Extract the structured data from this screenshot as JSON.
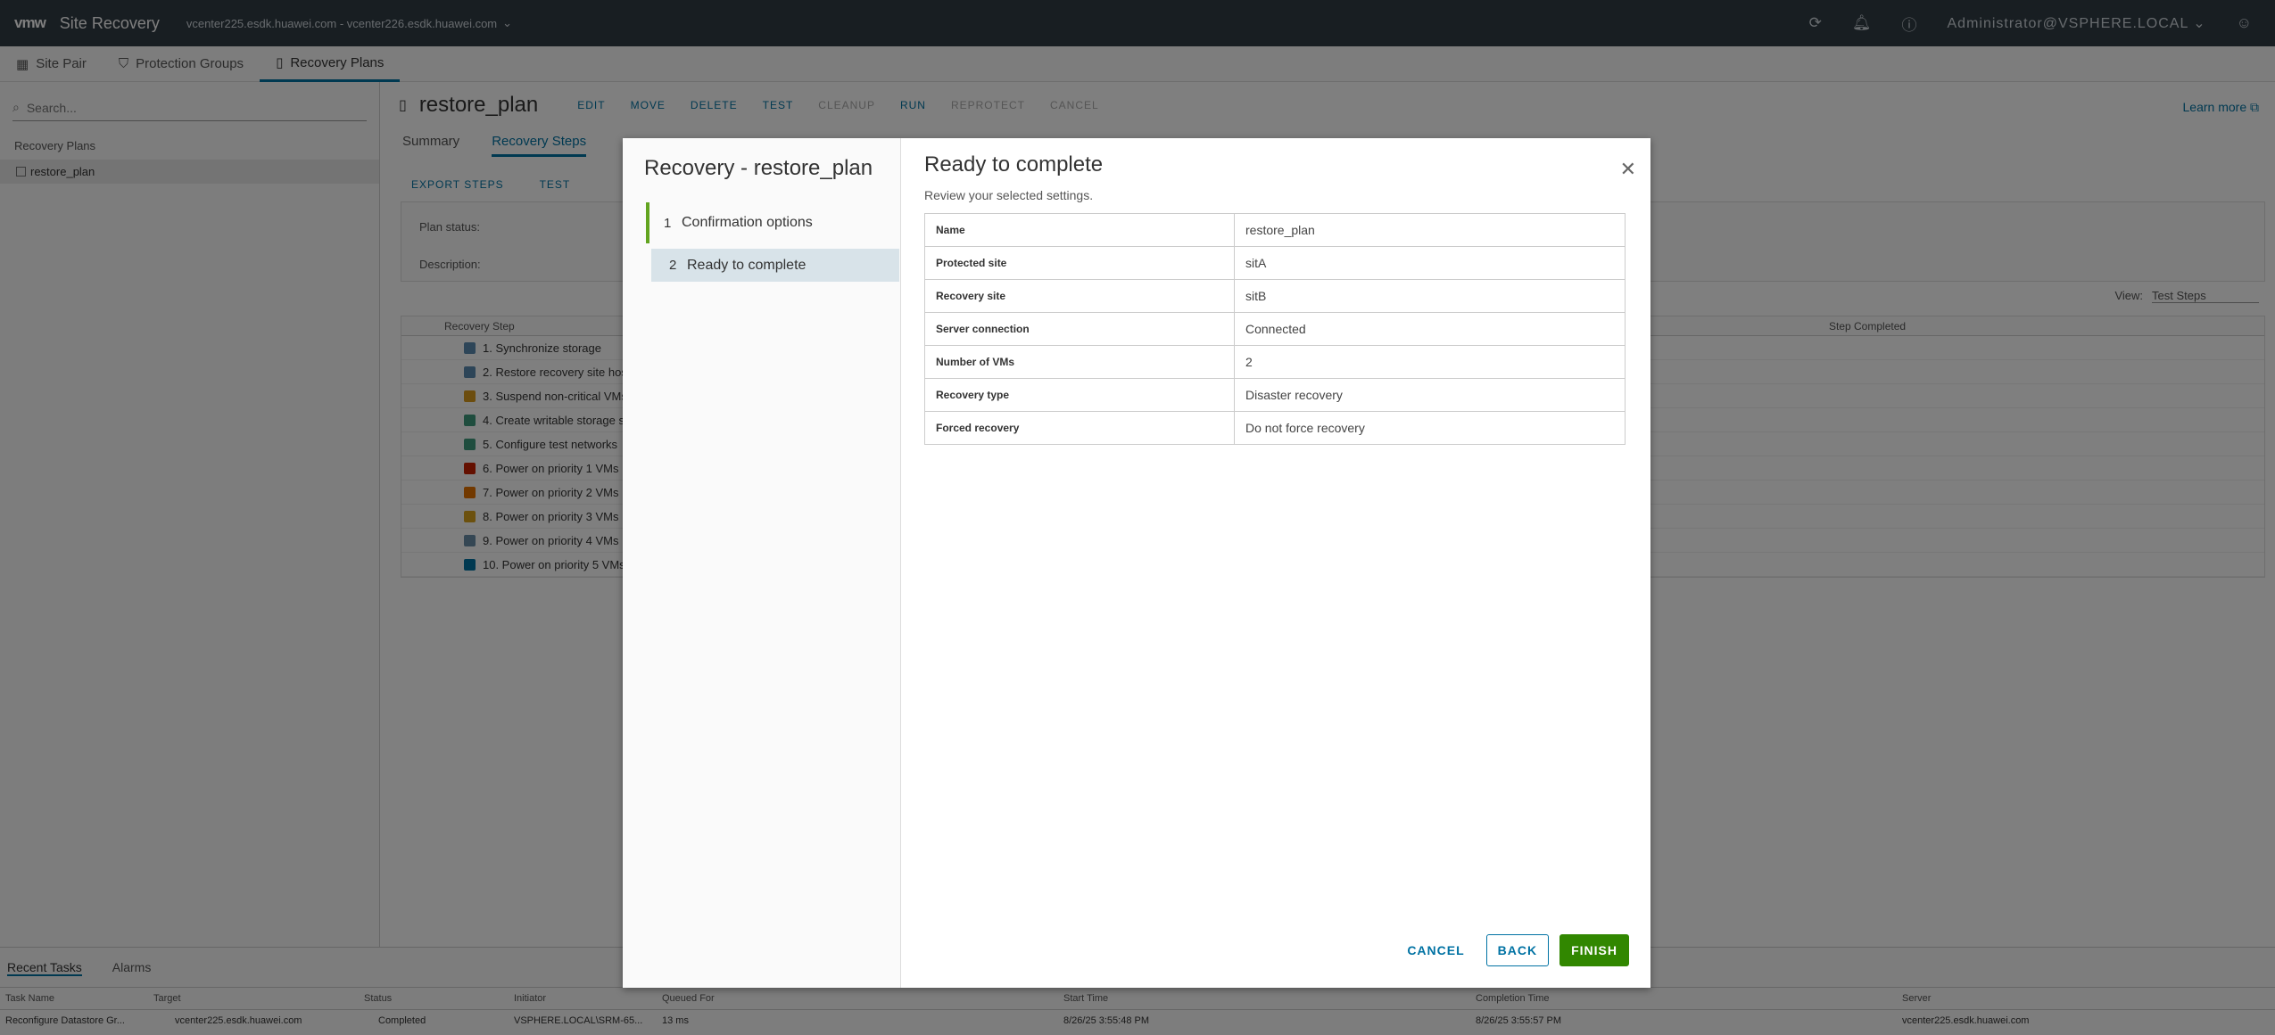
{
  "app": {
    "logo": "vmw",
    "title": "Site Recovery",
    "vcenter_pair": "vcenter225.esdk.huawei.com - vcenter226.esdk.huawei.com",
    "user": "Administrator@VSPHERE.LOCAL"
  },
  "nav": {
    "tabs": [
      "Site Pair",
      "Protection Groups",
      "Recovery Plans"
    ]
  },
  "left": {
    "search_placeholder": "Search...",
    "heading": "Recovery Plans",
    "item": "restore_plan"
  },
  "main": {
    "title": "restore_plan",
    "actions": [
      "EDIT",
      "MOVE",
      "DELETE",
      "TEST",
      "CLEANUP",
      "RUN",
      "REPROTECT",
      "CANCEL"
    ],
    "learn_more": "Learn more",
    "subtabs": [
      "Summary",
      "Recovery Steps"
    ],
    "step_actions": [
      "EXPORT STEPS",
      "TEST"
    ],
    "plan_status_label": "Plan status:",
    "description_label": "Description:",
    "view_label": "View:",
    "view_value": "Test Steps",
    "grid_headers": [
      "Recovery Step",
      "Step Completed"
    ],
    "steps": [
      {
        "label": "1. Synchronize storage",
        "color": "#5b8bb0"
      },
      {
        "label": "2. Restore recovery site hos",
        "color": "#5b8bb0"
      },
      {
        "label": "3. Suspend non-critical VMs",
        "color": "#d99a1c"
      },
      {
        "label": "4. Create writable storage s",
        "color": "#3e9a7d"
      },
      {
        "label": "5. Configure test networks",
        "color": "#3e9a7d"
      },
      {
        "label": "6. Power on priority 1 VMs",
        "color": "#c92100"
      },
      {
        "label": "7. Power on priority 2 VMs",
        "color": "#e57200"
      },
      {
        "label": "8. Power on priority 3 VMs",
        "color": "#d9a21c"
      },
      {
        "label": "9. Power on priority 4 VMs",
        "color": "#6b8ea8"
      },
      {
        "label": "10. Power on priority 5 VMs",
        "color": "#0072a3"
      }
    ]
  },
  "bottom": {
    "tabs": [
      "Recent Tasks",
      "Alarms"
    ],
    "headers": [
      "Task Name",
      "Target",
      "Status",
      "Initiator",
      "Queued For",
      "Start Time",
      "Completion Time",
      "Server"
    ],
    "row": [
      "Reconfigure Datastore Gr...",
      "vcenter225.esdk.huawei.com",
      "Completed",
      "VSPHERE.LOCAL\\SRM-65...",
      "13 ms",
      "8/26/25 3:55:48 PM",
      "8/26/25 3:55:57 PM",
      "vcenter225.esdk.huawei.com"
    ]
  },
  "modal": {
    "nav_title": "Recovery - restore_plan",
    "steps": [
      {
        "num": "1",
        "label": "Confirmation options"
      },
      {
        "num": "2",
        "label": "Ready to complete"
      }
    ],
    "title": "Ready to complete",
    "subtitle": "Review your selected settings.",
    "rows": [
      {
        "key": "Name",
        "value": "restore_plan"
      },
      {
        "key": "Protected site",
        "value": "sitA"
      },
      {
        "key": "Recovery site",
        "value": "sitB"
      },
      {
        "key": "Server connection",
        "value": "Connected"
      },
      {
        "key": "Number of VMs",
        "value": "2"
      },
      {
        "key": "Recovery type",
        "value": "Disaster recovery"
      },
      {
        "key": "Forced recovery",
        "value": "Do not force recovery"
      }
    ],
    "buttons": {
      "cancel": "CANCEL",
      "back": "BACK",
      "finish": "FINISH"
    }
  },
  "colors": {
    "accent": "#0072a3",
    "finish": "#318700",
    "step_done": "#62a420"
  }
}
